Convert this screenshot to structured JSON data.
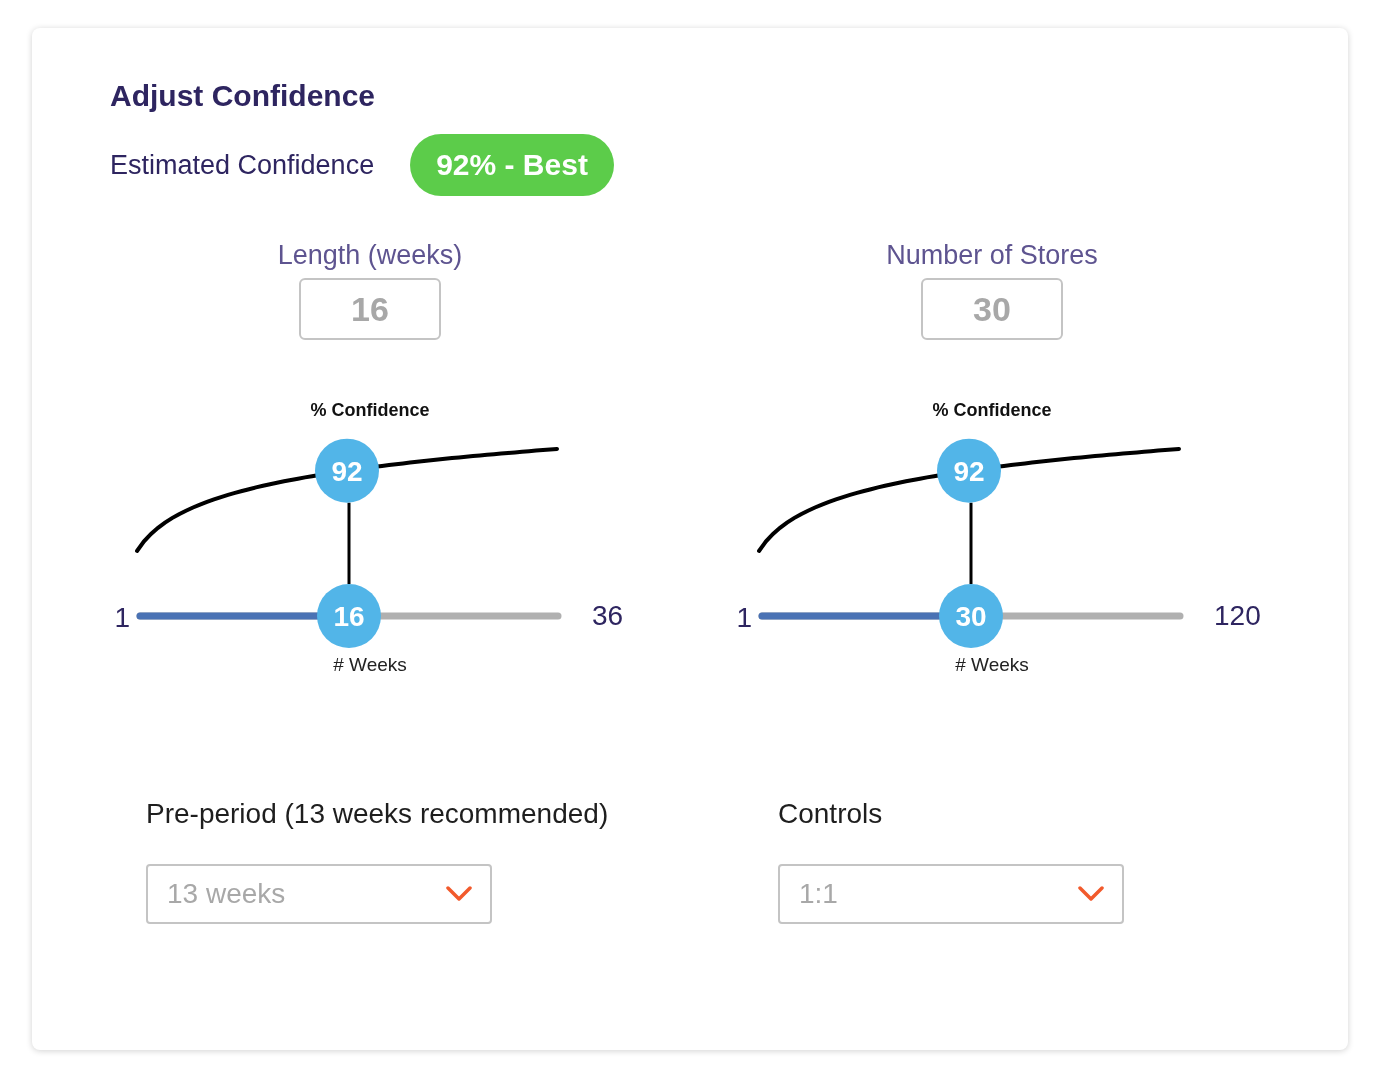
{
  "title": "Adjust Confidence",
  "estimate": {
    "label": "Estimated Confidence",
    "badge": "92% - Best"
  },
  "panels": [
    {
      "label": "Length (weeks)",
      "value": "16",
      "chart_title": "% Confidence",
      "confidence": "92",
      "slider": {
        "min_label": "1",
        "max_label": "36",
        "level": 0.5,
        "reading": "16",
        "axis_label": "# Weeks"
      }
    },
    {
      "label": "Number of Stores",
      "value": "30",
      "chart_title": "% Confidence",
      "confidence": "92",
      "slider": {
        "min_label": "1",
        "max_label": "120",
        "level": 0.5,
        "reading": "30",
        "axis_label": "# Weeks"
      }
    }
  ],
  "selects": [
    {
      "label": "Pre-period (13 weeks recommended)",
      "value": "13 weeks"
    },
    {
      "label": "Controls",
      "value": "1:1"
    }
  ]
}
